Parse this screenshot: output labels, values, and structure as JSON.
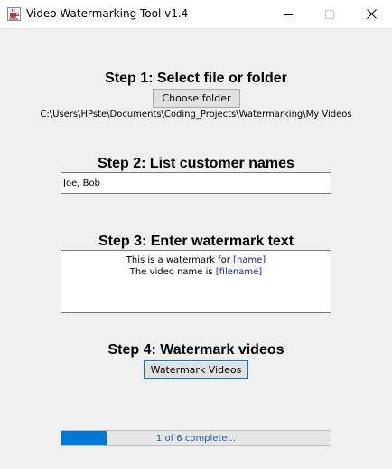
{
  "window": {
    "title": "Video Watermarking Tool v1.4",
    "icon": "java-coffee-cup-icon"
  },
  "step1": {
    "heading": "Step 1: Select file or folder",
    "button_label": "Choose folder",
    "path": "C:\\Users\\HPste\\Documents\\Coding_Projects\\Watermarking\\My Videos"
  },
  "step2": {
    "heading": "Step 2: List customer names",
    "names_value": "Joe, Bob"
  },
  "step3": {
    "heading": "Step 3: Enter watermark text",
    "line1_text": "This is a watermark for ",
    "line1_token": "[name]",
    "line2_text": "The video name is ",
    "line2_token": "[filename]"
  },
  "step4": {
    "heading": "Step 4: Watermark videos",
    "button_label": "Watermark Videos"
  },
  "progress": {
    "text": "1 of 6 complete...",
    "fraction": 0.1667,
    "fill_color": "#0078d7"
  }
}
